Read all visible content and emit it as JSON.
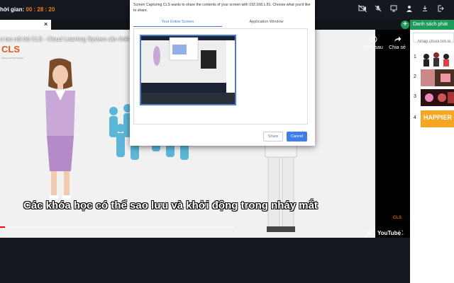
{
  "topbar": {
    "timer_label": "hời gian:",
    "timer_value": "00 : 28 : 20",
    "icons": [
      "camera-off-icon",
      "mic-off-icon",
      "screen-share-icon",
      "user-icon",
      "download-icon",
      "logout-icon"
    ]
  },
  "tab": {
    "close_glyph": "×"
  },
  "video": {
    "title": "o tạo nội bộ CLS - Cloud Learning System cần thiết ch",
    "logo": "CLS",
    "logo_sub": "Cloud Learning System",
    "subtitle": "Các khóa học có thể sao lưu và khởi động trong nháy mắt",
    "watch_later": "Xem sau",
    "share": "Chia sẻ",
    "youtube": "YouTube",
    "progress": 0.02,
    "corner_logo": "CLS"
  },
  "sidebar": {
    "title": "Danh sách phát",
    "search_placeholder": "Nhập chuỗi tìm ki",
    "items": [
      {
        "num": "1",
        "thumb_text": ""
      },
      {
        "num": "2",
        "thumb_text": ""
      },
      {
        "num": "3",
        "thumb_text": ""
      },
      {
        "num": "4",
        "thumb_text": "HAPPIER"
      }
    ]
  },
  "dialog": {
    "message": "Screen Capturing CLS wants to share the contents of your screen with 192.168.1.81. Choose what you'd like to share.",
    "tab_entire": "Your Entire Screen",
    "tab_window": "Application Window",
    "share_label": "Share",
    "cancel_label": "Cancel"
  },
  "colors": {
    "accent": "#1e9b5a",
    "timer": "#f07b1f",
    "primary": "#3f7fe5"
  }
}
